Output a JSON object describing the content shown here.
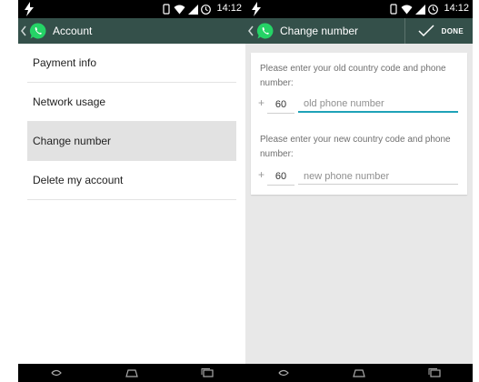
{
  "left_screen": {
    "status_time": "14:12",
    "title": "Account",
    "menu_items": [
      {
        "label": "Payment info",
        "selected": false
      },
      {
        "label": "Network usage",
        "selected": false
      },
      {
        "label": "Change number",
        "selected": true
      },
      {
        "label": "Delete my account",
        "selected": false
      }
    ]
  },
  "right_screen": {
    "status_time": "14:12",
    "title": "Change number",
    "done_label": "DONE",
    "old_prompt": "Please enter your old country code and phone number:",
    "old_plus": "+",
    "old_country_code": "60",
    "old_phone_placeholder": "old phone number",
    "new_prompt": "Please enter your new country code and phone number:",
    "new_plus": "+",
    "new_country_code": "60",
    "new_phone_placeholder": "new phone number"
  },
  "colors": {
    "action_bar": "#34504a",
    "selected_row": "#e2e2e2",
    "focus_underline": "#1ea2b8",
    "whatsapp_green": "#25d366"
  },
  "icons": [
    "lightning-icon",
    "rotate-icon",
    "wifi-icon",
    "signal-icon",
    "clock-icon",
    "back-chevron-icon",
    "whatsapp-logo-icon",
    "check-icon",
    "nav-back-icon",
    "nav-home-icon",
    "nav-recents-icon"
  ]
}
